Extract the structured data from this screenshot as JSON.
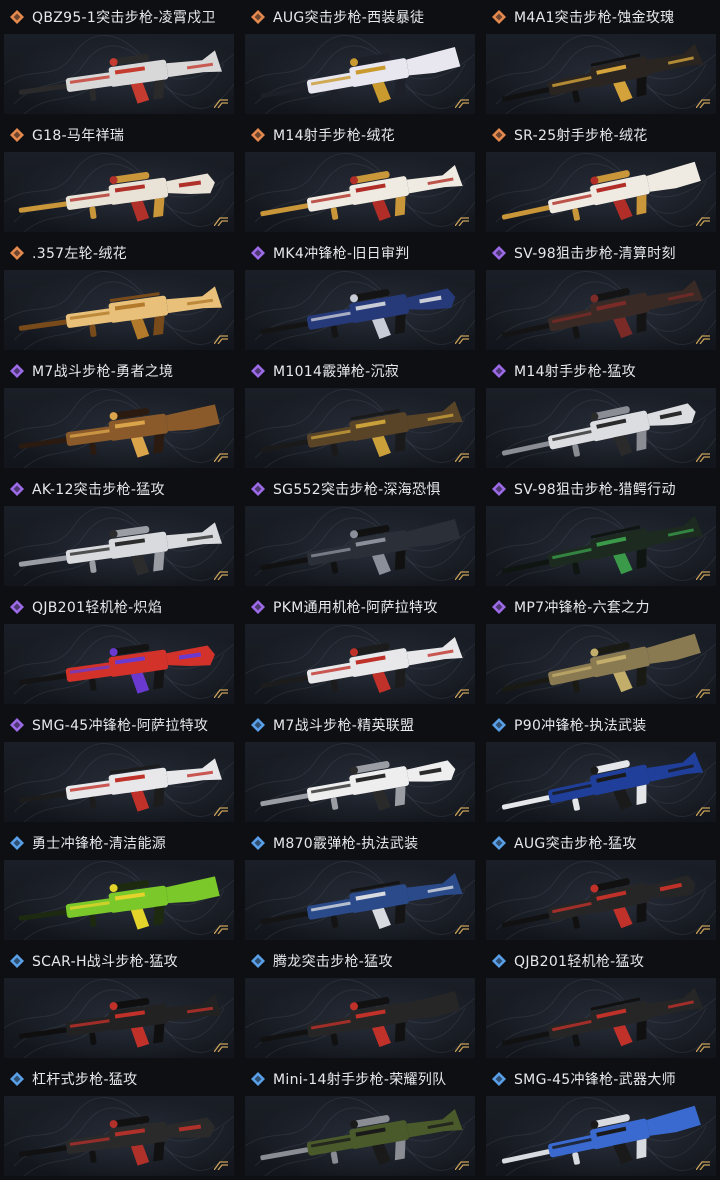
{
  "skins": [
    {
      "label": "QBZ95-1突击步枪-凌霄戍卫",
      "rarity": "legendary",
      "body": "#d8d8d8",
      "accent": "#c63b2f",
      "trim": "#2a2a2a"
    },
    {
      "label": "AUG突击步枪-西装暴徒",
      "rarity": "legendary",
      "body": "#e8e6ef",
      "accent": "#c99a2e",
      "trim": "#1d1f29"
    },
    {
      "label": "M4A1突击步枪-蚀金玫瑰",
      "rarity": "legendary",
      "body": "#2a2520",
      "accent": "#d4a23a",
      "trim": "#111111"
    },
    {
      "label": "G18-马年祥瑞",
      "rarity": "legendary",
      "body": "#e9e2d6",
      "accent": "#b0302a",
      "trim": "#c9963a"
    },
    {
      "label": "M14射手步枪-绒花",
      "rarity": "legendary",
      "body": "#f0ebe2",
      "accent": "#b02e27",
      "trim": "#c9963a"
    },
    {
      "label": "SR-25射手步枪-绒花",
      "rarity": "legendary",
      "body": "#f0ebe2",
      "accent": "#b02e27",
      "trim": "#c9963a"
    },
    {
      "label": ".357左轮-绒花",
      "rarity": "legendary",
      "body": "#e8c07a",
      "accent": "#b27a2a",
      "trim": "#7a4b1a"
    },
    {
      "label": "MK4冲锋枪-旧日审判",
      "rarity": "epic",
      "body": "#263a7a",
      "accent": "#c8ccd6",
      "trim": "#141414"
    },
    {
      "label": "SV-98狙击步枪-清算时刻",
      "rarity": "epic",
      "body": "#3a2a26",
      "accent": "#7a2b28",
      "trim": "#141414"
    },
    {
      "label": "M7战斗步枪-勇者之境",
      "rarity": "epic",
      "body": "#8a5a2b",
      "accent": "#d9a44a",
      "trim": "#2a1a10"
    },
    {
      "label": "M1014霰弹枪-沉寂",
      "rarity": "epic",
      "body": "#5a4428",
      "accent": "#c9a03a",
      "trim": "#1a1a1a"
    },
    {
      "label": "M14射手步枪-猛攻",
      "rarity": "epic",
      "body": "#dcdde0",
      "accent": "#2a2a2a",
      "trim": "#8a8d93"
    },
    {
      "label": "AK-12突击步枪-猛攻",
      "rarity": "epic",
      "body": "#d9dadd",
      "accent": "#2c2c2c",
      "trim": "#9a9da3"
    },
    {
      "label": "SG552突击步枪-深海恐惧",
      "rarity": "epic",
      "body": "#2b2f38",
      "accent": "#8a8f9a",
      "trim": "#111111"
    },
    {
      "label": "SV-98狙击步枪-猎鳄行动",
      "rarity": "epic",
      "body": "#1c2a20",
      "accent": "#3a9a4a",
      "trim": "#0f1511"
    },
    {
      "label": "QJB201轻机枪-炽焰",
      "rarity": "epic",
      "body": "#d2322a",
      "accent": "#6a3ad0",
      "trim": "#141414"
    },
    {
      "label": "PKM通用机枪-阿萨拉特攻",
      "rarity": "epic",
      "body": "#e8e8ea",
      "accent": "#c0312a",
      "trim": "#1c1c1c"
    },
    {
      "label": "MP7冲锋枪-六套之力",
      "rarity": "epic",
      "body": "#8a7a52",
      "accent": "#c2ad6a",
      "trim": "#1a1a14"
    },
    {
      "label": "SMG-45冲锋枪-阿萨拉特攻",
      "rarity": "epic",
      "body": "#e8e8ea",
      "accent": "#c0312a",
      "trim": "#1c1c1c"
    },
    {
      "label": "M7战斗步枪-精英联盟",
      "rarity": "rare",
      "body": "#eeeeee",
      "accent": "#2a2a2a",
      "trim": "#9a9da3"
    },
    {
      "label": "P90冲锋枪-执法武装",
      "rarity": "rare",
      "body": "#1f3f9a",
      "accent": "#1a1a1a",
      "trim": "#e4e6ea"
    },
    {
      "label": "勇士冲锋枪-清洁能源",
      "rarity": "rare",
      "body": "#7ac82a",
      "accent": "#e3d32a",
      "trim": "#1d2a10"
    },
    {
      "label": "M870霰弹枪-执法武装",
      "rarity": "rare",
      "body": "#2a4a8a",
      "accent": "#d8dbe0",
      "trim": "#141414"
    },
    {
      "label": "AUG突击步枪-猛攻",
      "rarity": "rare",
      "body": "#262626",
      "accent": "#c0312a",
      "trim": "#111111"
    },
    {
      "label": "SCAR-H战斗步枪-猛攻",
      "rarity": "rare",
      "body": "#222222",
      "accent": "#c0312a",
      "trim": "#0f0f0f"
    },
    {
      "label": "腾龙突击步枪-猛攻",
      "rarity": "rare",
      "body": "#262626",
      "accent": "#c0312a",
      "trim": "#111111"
    },
    {
      "label": "QJB201轻机枪-猛攻",
      "rarity": "rare",
      "body": "#262626",
      "accent": "#c0312a",
      "trim": "#111111"
    },
    {
      "label": "杠杆式步枪-猛攻",
      "rarity": "rare",
      "body": "#2a2a2a",
      "accent": "#b0302a",
      "trim": "#111111"
    },
    {
      "label": "Mini-14射手步枪-荣耀列队",
      "rarity": "rare",
      "body": "#4a5a2a",
      "accent": "#1a1a1a",
      "trim": "#8a8d93"
    },
    {
      "label": "SMG-45冲锋枪-武器大师",
      "rarity": "rare",
      "body": "#3a6ad0",
      "accent": "#1a1a1a",
      "trim": "#d8dbe0"
    }
  ],
  "rarity_colors": {
    "legendary": "#e58a4e",
    "epic": "#9d6be8",
    "rare": "#5aa0e8"
  }
}
